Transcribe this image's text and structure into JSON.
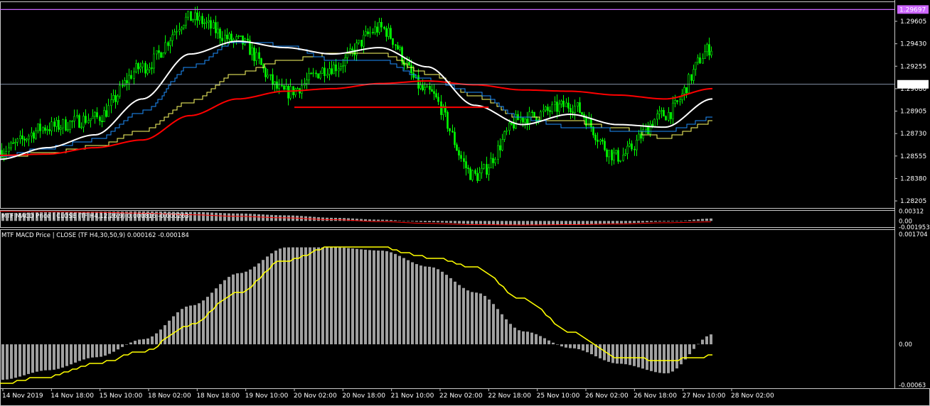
{
  "colors": {
    "background": "#000000",
    "frame": "#c8c8c8",
    "bull_candle": "#00ff00",
    "bear_candle": "#00ff00",
    "ma_white": "#ffffff",
    "ma_blue": "#1e90ff",
    "ma_yellow_thin": "#ffff66",
    "ma_red": "#ff0000",
    "horizontal_line_purple": "#cc66ff",
    "histogram": "#a0a0a0",
    "signal_line": "#ffff00",
    "current_price_line": "#b0c4de"
  },
  "main_panel": {
    "price_tags": {
      "upper_line": "1.29697",
      "current": "1.29114"
    },
    "y_ticks": [
      "1.29605",
      "1.29430",
      "1.29255",
      "1.29080",
      "1.28905",
      "1.28730",
      "1.28555",
      "1.28380",
      "1.28205"
    ]
  },
  "indicator1": {
    "label": "MTF MACD Price | CLOSE  (TF H4,12,26,9) 0.000816 -0.000263",
    "y_ticks": [
      "0.00312",
      "0.00",
      "-0.001953"
    ]
  },
  "indicator2": {
    "label": "MTF MACD Price | CLOSE  (TF H4,30,50,9) 0.000162 -0.000184",
    "y_ticks": [
      "0.001704",
      "0.00",
      "-0.00063"
    ]
  },
  "x_axis": {
    "ticks": [
      "14 Nov 2019",
      "14 Nov 18:00",
      "15 Nov 10:00",
      "18 Nov 02:00",
      "18 Nov 18:00",
      "19 Nov 10:00",
      "20 Nov 02:00",
      "20 Nov 18:00",
      "21 Nov 10:00",
      "22 Nov 02:00",
      "22 Nov 18:00",
      "25 Nov 10:00",
      "26 Nov 02:00",
      "26 Nov 18:00",
      "27 Nov 10:00",
      "28 Nov 02:00"
    ]
  },
  "chart_data": {
    "type": "line",
    "title": "",
    "symbol_timeframe": "",
    "price_range": [
      1.2815,
      1.2976
    ],
    "horizontal_line": 1.29697,
    "current_price": 1.29114,
    "support_segment": {
      "from": "20 Nov 02:00",
      "to": "22 Nov 18:00",
      "price": 1.28935
    },
    "price_anchors": [
      {
        "t": "14 Nov 2019",
        "price": 1.286
      },
      {
        "t": "14 Nov 18:00",
        "price": 1.2878
      },
      {
        "t": "15 Nov 10:00",
        "price": 1.2885
      },
      {
        "t": "18 Nov 02:00",
        "price": 1.2925
      },
      {
        "t": "18 Nov 18:00",
        "price": 1.2963
      },
      {
        "t": "19 Nov 10:00",
        "price": 1.2945
      },
      {
        "t": "20 Nov 02:00",
        "price": 1.2905
      },
      {
        "t": "20 Nov 18:00",
        "price": 1.2925
      },
      {
        "t": "21 Nov 10:00",
        "price": 1.2955
      },
      {
        "t": "22 Nov 02:00",
        "price": 1.2905
      },
      {
        "t": "22 Nov 18:00",
        "price": 1.284
      },
      {
        "t": "25 Nov 10:00",
        "price": 1.2885
      },
      {
        "t": "26 Nov 02:00",
        "price": 1.2895
      },
      {
        "t": "26 Nov 18:00",
        "price": 1.2855
      },
      {
        "t": "27 Nov 10:00",
        "price": 1.2888
      },
      {
        "t": "28 Nov 02:00",
        "price": 1.294
      }
    ],
    "ma_red": [
      1.2856,
      1.2857,
      1.2862,
      1.2868,
      1.2887,
      1.29,
      1.2906,
      1.2908,
      1.2912,
      1.2914,
      1.2911,
      1.2907,
      1.2906,
      1.2903,
      1.29,
      1.2908
    ],
    "ma_white": [
      1.2853,
      1.2862,
      1.2872,
      1.29,
      1.2935,
      1.2945,
      1.294,
      1.2935,
      1.294,
      1.2925,
      1.2895,
      1.288,
      1.2888,
      1.288,
      1.2878,
      1.29
    ],
    "ma_blue": [
      1.2855,
      1.2862,
      1.2868,
      1.289,
      1.2925,
      1.2945,
      1.2942,
      1.293,
      1.293,
      1.2915,
      1.2905,
      1.2885,
      1.2878,
      1.2876,
      1.2875,
      1.2885
    ],
    "ma_yellow_thin": [
      1.2855,
      1.2858,
      1.2863,
      1.2875,
      1.2898,
      1.292,
      1.293,
      1.2935,
      1.2935,
      1.292,
      1.2902,
      1.2885,
      1.2883,
      1.2877,
      1.287,
      1.2882
    ],
    "macd1_histogram": [
      0.0025,
      0.0028,
      0.003,
      0.0031,
      0.0029,
      0.0024,
      0.0018,
      0.001,
      0.0004,
      -0.0004,
      -0.001,
      -0.0014,
      -0.0012,
      -0.0008,
      -0.0002,
      0.0008
    ],
    "macd1_signal": [
      0.0031,
      0.003,
      0.0028,
      0.0025,
      0.002,
      0.0015,
      0.001,
      0.0004,
      -0.0002,
      -0.0008,
      -0.0012,
      -0.0013,
      -0.0012,
      -0.001,
      -0.0006,
      -0.0003
    ],
    "macd2_histogram": [
      -0.00055,
      -0.0004,
      -0.0002,
      8e-05,
      0.0006,
      0.0011,
      0.0015,
      0.0015,
      0.00145,
      0.0012,
      0.0008,
      0.0002,
      -6e-05,
      -0.0003,
      -0.00045,
      0.00016
    ],
    "macd2_signal": [
      -0.0006,
      -0.0005,
      -0.0003,
      -0.00012,
      0.0003,
      0.0008,
      0.0013,
      0.0015,
      0.0015,
      0.00135,
      0.0012,
      0.0007,
      0.0002,
      -0.0002,
      -0.00025,
      -0.00018
    ]
  }
}
